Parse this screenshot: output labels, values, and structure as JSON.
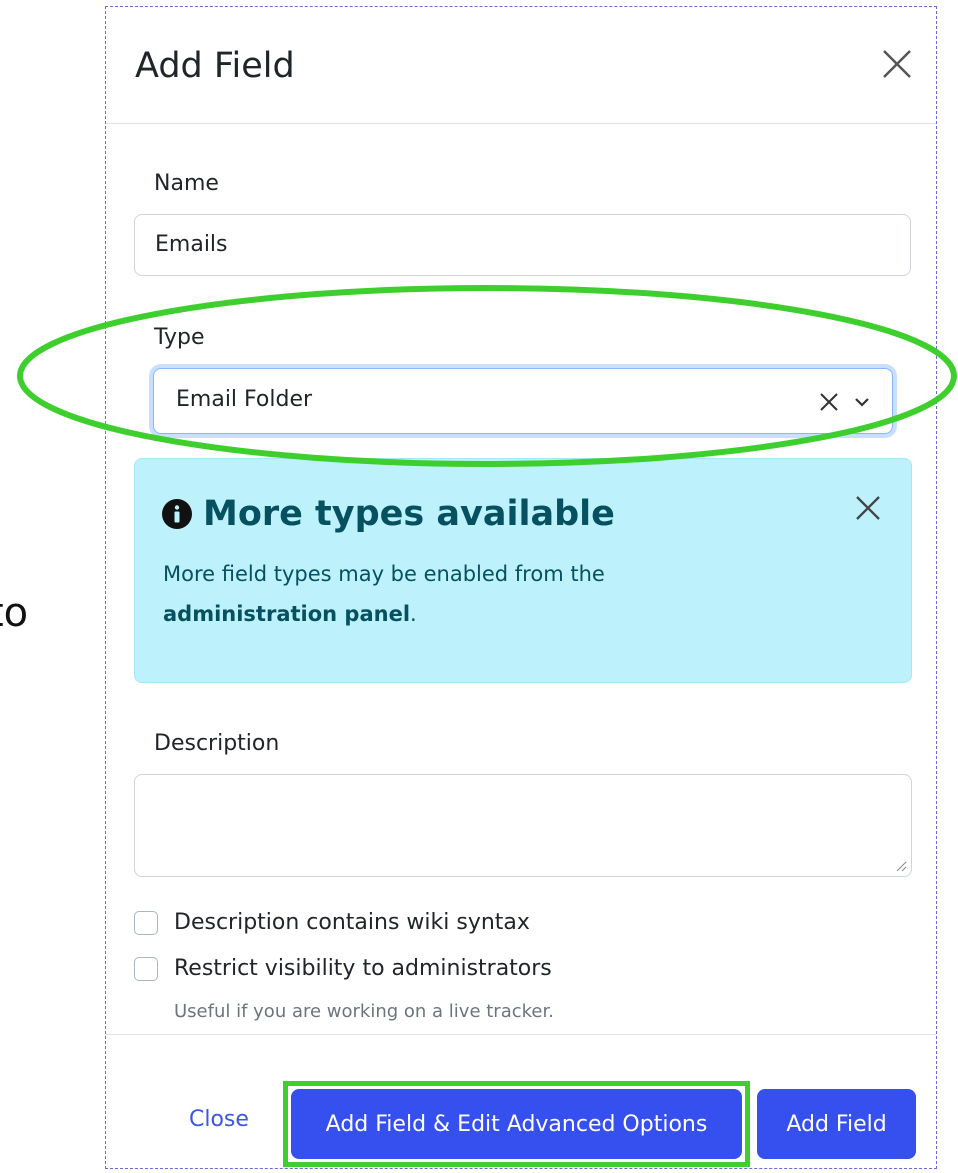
{
  "side_text": "to",
  "modal": {
    "title": "Add Field",
    "name_label": "Name",
    "name_value": "Emails",
    "type_label": "Type",
    "type_value": "Email Folder",
    "alert": {
      "heading": "More types available",
      "text_prefix": "More field types may be enabled from the",
      "text_link": "administration panel",
      "text_suffix": "."
    },
    "description_label": "Description",
    "description_value": "",
    "checkbox_wiki_label": "Description contains wiki syntax",
    "checkbox_wiki_checked": false,
    "checkbox_restrict_label": "Restrict visibility to administrators",
    "checkbox_restrict_checked": false,
    "restrict_help": "Useful if you are working on a live tracker.",
    "footer": {
      "close_label": "Close",
      "advanced_label": "Add Field & Edit Advanced Options",
      "add_label": "Add Field"
    }
  },
  "colors": {
    "primary": "#3650f0",
    "link": "#3a56e8",
    "alert_bg": "#bdf1fb",
    "alert_text": "#055160",
    "annotation_green": "#3ecf2e"
  },
  "icons": {
    "close": "close-icon",
    "info": "info-circle-icon",
    "clear": "clear-icon",
    "chevron": "chevron-down-icon"
  }
}
